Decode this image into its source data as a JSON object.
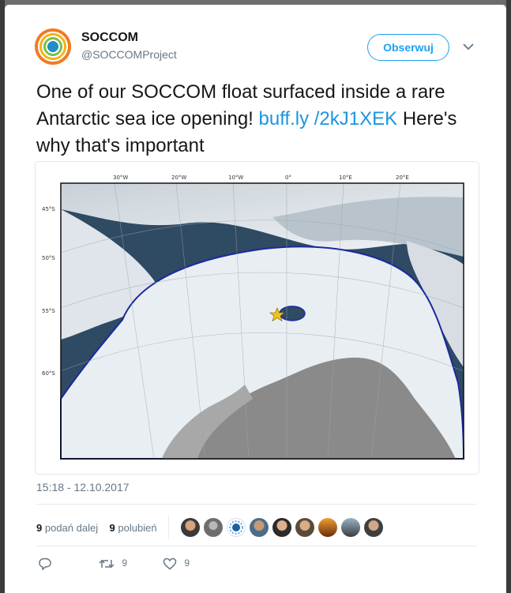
{
  "account": {
    "display_name": "SOCCOM",
    "screen_name": "@SOCCOMProject",
    "avatar_icon": "soccom-logo-icon"
  },
  "header": {
    "follow_label": "Obserwuj"
  },
  "tweet": {
    "text_before": "One of our SOCCOM float surfaced inside a rare Antarctic sea ice opening!",
    "link": "buff.ly /2kJ1XEK",
    "text_after": "Here's why that's important",
    "timestamp": "15:18 - 12.10.2017"
  },
  "map": {
    "lon_labels": [
      "30°W",
      "20°W",
      "10°W",
      "0°",
      "10°E",
      "20°E"
    ],
    "lat_labels": [
      "45°S",
      "50°S",
      "55°S",
      "60°S"
    ],
    "colors": {
      "ocean": "#2f4a63",
      "ice": "#e9eef2",
      "land": "#8a8a8a",
      "ice_edge": "#1a2a9e",
      "float": "#f2c21b"
    }
  },
  "stats": {
    "retweet_count": "9",
    "retweet_label": "podań dalej",
    "like_count": "9",
    "like_label": "polubień"
  },
  "actions": {
    "retweets": "9",
    "likes": "9"
  }
}
